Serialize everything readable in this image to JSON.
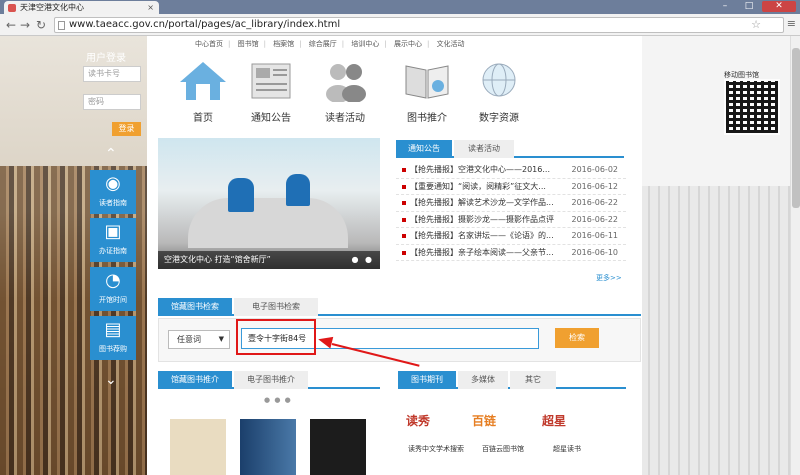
{
  "browser": {
    "tab_title": "天津空港文化中心",
    "tab_close": "×",
    "url": "www.taeacc.gov.cn/portal/pages/ac_library/index.html",
    "back": "←",
    "forward": "→",
    "reload": "↻",
    "star": "☆",
    "menu": "≡",
    "win_min": "–",
    "win_max": "□",
    "win_close": "✕"
  },
  "login": {
    "title": "用户登录",
    "card_placeholder": "读书卡号",
    "password_placeholder": "密码",
    "button": "登录"
  },
  "sidebar": {
    "up": "⌃",
    "down": "⌄",
    "items": [
      {
        "label": "读者指南",
        "icon": "◉"
      },
      {
        "label": "办证指南",
        "icon": "▣"
      },
      {
        "label": "开馆时间",
        "icon": "◔"
      },
      {
        "label": "图书荐购",
        "icon": "▤"
      }
    ]
  },
  "topnav": [
    "中心首页",
    "图书馆",
    "档案馆",
    "综合展厅",
    "培训中心",
    "展示中心",
    "文化活动"
  ],
  "categories": [
    "首页",
    "通知公告",
    "读者活动",
    "图书推介",
    "数字资源"
  ],
  "qr": {
    "label": "移动图书馆"
  },
  "hero": {
    "caption": "空港文化中心 打造“馆舍新厅”",
    "dots": "● ●"
  },
  "news": {
    "tabs": [
      "通知公告",
      "读者活动"
    ],
    "items": [
      {
        "title": "【抢先播报】空港文化中心——2016...",
        "date": "2016-06-02"
      },
      {
        "title": "【重要通知】“阅读，阅精彩”征文大...",
        "date": "2016-06-12"
      },
      {
        "title": "【抢先播报】解读艺术沙龙—文学作品...",
        "date": "2016-06-22"
      },
      {
        "title": "【抢先播报】摄影沙龙——摄影作品点评",
        "date": "2016-06-22"
      },
      {
        "title": "【抢先播报】名家讲坛——《论语》的...",
        "date": "2016-06-11"
      },
      {
        "title": "【抢先播报】亲子绘本阅读——父亲节...",
        "date": "2016-06-10"
      }
    ],
    "more": "更多>>"
  },
  "search": {
    "tabs": [
      "馆藏图书检索",
      "电子图书检索"
    ],
    "select_value": "任意词",
    "select_caret": "▼",
    "query": "壹令十字街84号",
    "button": "检索"
  },
  "recommend": {
    "tabs": [
      "馆藏图书推介",
      "电子图书推介"
    ],
    "pager": "● ● ●"
  },
  "periodicals": {
    "tabs": [
      "图书期刊",
      "多媒体",
      "其它"
    ],
    "logos": [
      "读秀",
      "百链",
      "超星"
    ],
    "labels": [
      "读秀中文学术搜索",
      "百链云图书馆",
      "超星读书"
    ]
  }
}
